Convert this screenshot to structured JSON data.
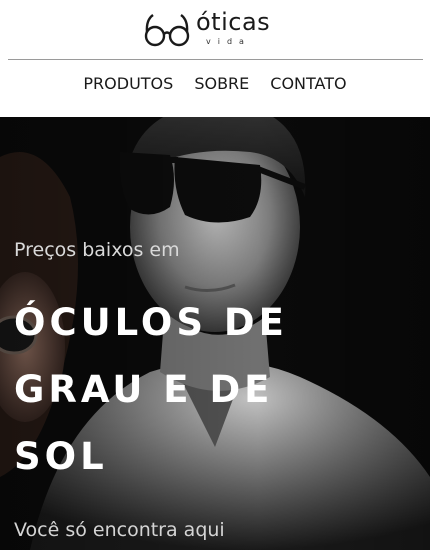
{
  "brand": {
    "name": "óticas",
    "tagline": "vida"
  },
  "nav": {
    "items": [
      "PRODUTOS",
      "SOBRE",
      "CONTATO"
    ]
  },
  "hero": {
    "pretitle": "Preços baixos em",
    "title": "ÓCULOS DE GRAU E DE SOL",
    "subtitle": "Você só encontra aqui",
    "image": "man-with-sunglasses-and-woman-photo"
  },
  "colors": {
    "header_bg": "#ffffff",
    "text_dark": "#1a1a1a",
    "hero_bg": "#0b0b0b",
    "hero_title": "#ffffff"
  }
}
